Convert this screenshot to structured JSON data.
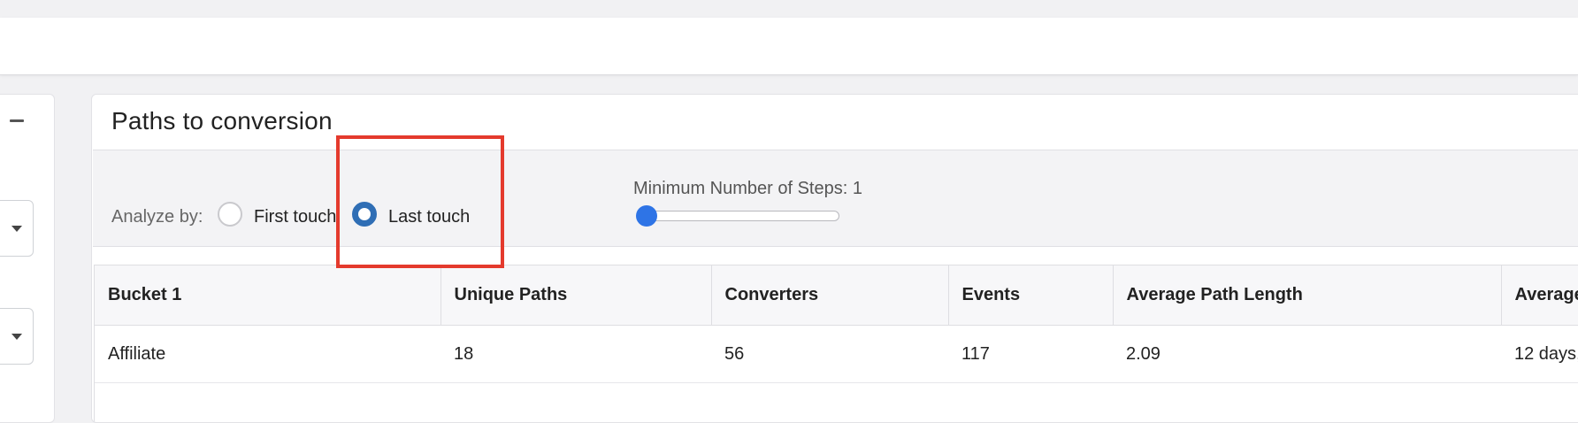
{
  "card": {
    "title": "Paths to conversion"
  },
  "controls": {
    "analyze_label": "Analyze by:",
    "options": [
      {
        "label": "First touch",
        "selected": false
      },
      {
        "label": "Last touch",
        "selected": true
      }
    ],
    "slider": {
      "label": "Minimum Number of Steps: 1",
      "value": 1
    }
  },
  "table": {
    "headers": [
      "Bucket 1",
      "Unique Paths",
      "Converters",
      "Events",
      "Average Path Length",
      "Average"
    ],
    "rows": [
      [
        "Affiliate",
        "18",
        "56",
        "117",
        "2.09",
        "12 days,"
      ],
      [
        "",
        "",
        "",
        "",
        "",
        ""
      ]
    ]
  },
  "colors": {
    "accent": "#2e74e6",
    "radio_selected": "#2f6eb5",
    "highlight": "#e43a2d"
  }
}
